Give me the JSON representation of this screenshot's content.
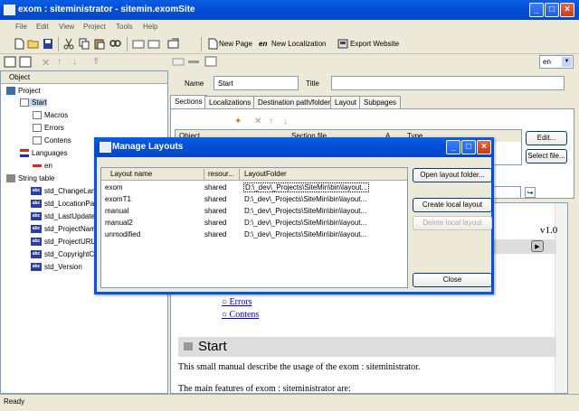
{
  "window": {
    "title": "exom : siteministrator - sitemin.exomSite"
  },
  "menu": [
    "File",
    "Edit",
    "View",
    "Project",
    "Tools",
    "Help"
  ],
  "toolbar": {
    "new_page": "New Page",
    "en_label": "en",
    "new_localization": "New Localization",
    "export_website": "Export Website",
    "lang_value": "en"
  },
  "left": {
    "header": "Object",
    "tree": [
      {
        "label": "Project",
        "level": 0,
        "icon": "project-icon"
      },
      {
        "label": "Start",
        "level": 1,
        "icon": "page-icon"
      },
      {
        "label": "Macros",
        "level": 2,
        "icon": "page-icon"
      },
      {
        "label": "Errors",
        "level": 2,
        "icon": "page-icon"
      },
      {
        "label": "Contens",
        "level": 2,
        "icon": "page-icon"
      },
      {
        "label": "Languages",
        "level": 1,
        "icon": "languages-icon"
      },
      {
        "label": "en",
        "level": 2,
        "icon": "flag-icon"
      },
      {
        "label": "String table",
        "level": 1,
        "icon": "string-table-icon"
      },
      {
        "label": "std_ChangeLan",
        "level": 2,
        "icon": "abc-icon"
      },
      {
        "label": "std_LocationPa",
        "level": 2,
        "icon": "abc-icon"
      },
      {
        "label": "std_LastUpdate",
        "level": 2,
        "icon": "abc-icon"
      },
      {
        "label": "std_ProjectNam",
        "level": 2,
        "icon": "abc-icon"
      },
      {
        "label": "std_ProjectURL",
        "level": 2,
        "icon": "abc-icon"
      },
      {
        "label": "std_CopyrightC",
        "level": 2,
        "icon": "abc-icon"
      },
      {
        "label": "std_Version",
        "level": 2,
        "icon": "abc-icon"
      }
    ]
  },
  "props": {
    "name_label": "Name",
    "name_value": "Start",
    "title_label": "Title",
    "title_value": ""
  },
  "tabs": [
    "Sections",
    "Localizations",
    "Destination path/folder",
    "Layout",
    "Subpages"
  ],
  "sections_table": {
    "col_object": "Object",
    "col_section": "Section file",
    "col_a": "A...",
    "col_type": "Type"
  },
  "side_buttons": {
    "edit": "Edit...",
    "select_file": "Select file..."
  },
  "preview": {
    "version": "v1.0",
    "links": [
      "Errors",
      "Contens"
    ],
    "heading": "Start",
    "para1": "This small manual describe the usage of the exom : siteministrator.",
    "para2": "The main features of exom : siteministrator are:"
  },
  "status": "Ready",
  "dialog": {
    "title": "Manage Layouts",
    "columns": [
      "Layout name",
      "resour...",
      "LayoutFolder"
    ],
    "rows": [
      {
        "name": "exom",
        "resource": "shared",
        "folder": "D:\\_dev\\_Projects\\SiteMin\\bin\\layout..."
      },
      {
        "name": "exomT1",
        "resource": "shared",
        "folder": "D:\\_dev\\_Projects\\SiteMin\\bin\\layout..."
      },
      {
        "name": "manual",
        "resource": "shared",
        "folder": "D:\\_dev\\_Projects\\SiteMin\\bin\\layout..."
      },
      {
        "name": "manual2",
        "resource": "shared",
        "folder": "D:\\_dev\\_Projects\\SiteMin\\bin\\layout..."
      },
      {
        "name": "unmodified",
        "resource": "shared",
        "folder": "D:\\_dev\\_Projects\\SiteMin\\bin\\layout..."
      }
    ],
    "open_folder": "Open layout folder...",
    "create_local": "Create local layout",
    "delete_local": "Delete local layout",
    "close": "Close"
  }
}
